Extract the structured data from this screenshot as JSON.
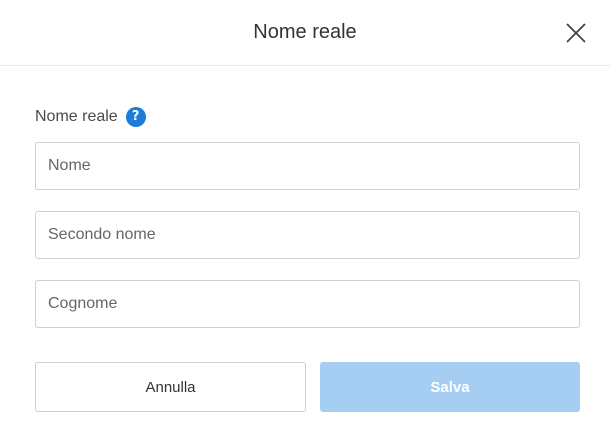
{
  "dialog": {
    "title": "Nome reale",
    "close_icon": "close-icon"
  },
  "form": {
    "label": "Nome reale",
    "help_icon": "help-icon",
    "help_glyph": "?",
    "first_name": {
      "value": "",
      "placeholder": "Nome"
    },
    "middle_name": {
      "value": "",
      "placeholder": "Secondo nome"
    },
    "last_name": {
      "value": "",
      "placeholder": "Cognome"
    }
  },
  "actions": {
    "cancel_label": "Annulla",
    "save_label": "Salva",
    "save_enabled": false
  },
  "colors": {
    "accent": "#1a7ddb",
    "save_disabled_bg": "#a6cdf2",
    "border": "#cfcfcf"
  }
}
